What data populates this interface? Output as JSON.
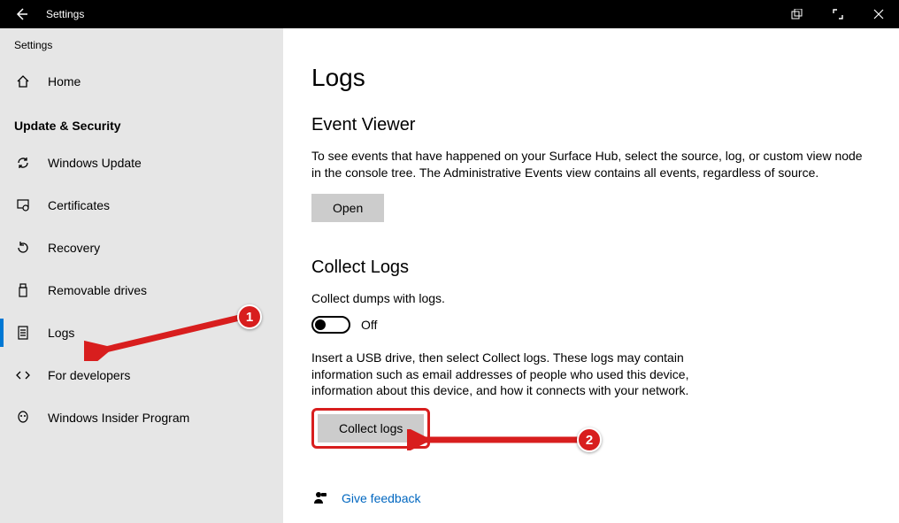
{
  "titlebar": {
    "title": "Settings"
  },
  "sidebar": {
    "app_label": "Settings",
    "home": "Home",
    "section": "Update & Security",
    "items": [
      {
        "label": "Windows Update"
      },
      {
        "label": "Certificates"
      },
      {
        "label": "Recovery"
      },
      {
        "label": "Removable drives"
      },
      {
        "label": "Logs"
      },
      {
        "label": "For developers"
      },
      {
        "label": "Windows Insider Program"
      }
    ]
  },
  "main": {
    "title": "Logs",
    "eventviewer": {
      "heading": "Event Viewer",
      "desc": "To see events that have happened on your Surface Hub, select the source, log, or custom view node in the console tree. The Administrative Events view contains all events, regardless of source.",
      "open": "Open"
    },
    "collect": {
      "heading": "Collect Logs",
      "dumps_label": "Collect dumps with logs.",
      "toggle_state": "Off",
      "usb_desc": "Insert a USB drive, then select Collect logs. These logs may contain information such as email addresses of people who used this device, information about this device, and how it connects with your network.",
      "button": "Collect logs"
    },
    "feedback": "Give feedback"
  },
  "annotations": {
    "badge1": "1",
    "badge2": "2"
  }
}
